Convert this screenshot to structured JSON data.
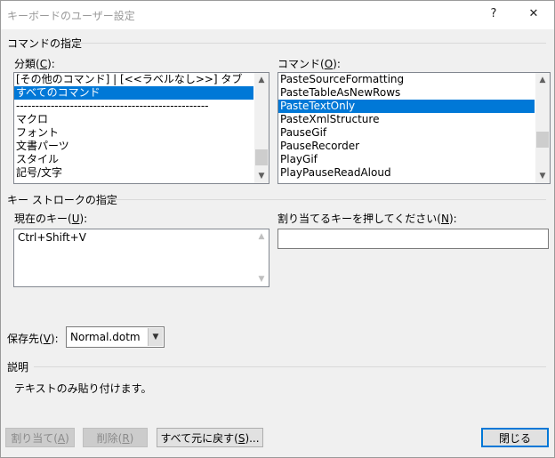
{
  "window": {
    "title": "キーボードのユーザー設定",
    "help_glyph": "?",
    "close_glyph": "✕"
  },
  "command_spec": {
    "heading": "コマンドの指定",
    "categories": {
      "label_pre": "分類(",
      "label_key": "C",
      "label_post": "):",
      "items": [
        {
          "text": "[その他のコマンド] | [<<ラベルなし>>] タブ",
          "selected": false
        },
        {
          "text": "すべてのコマンド",
          "selected": true
        },
        {
          "text": "--------------------------------------------------",
          "selected": false
        },
        {
          "text": "マクロ",
          "selected": false
        },
        {
          "text": "フォント",
          "selected": false
        },
        {
          "text": "文書パーツ",
          "selected": false
        },
        {
          "text": "スタイル",
          "selected": false
        },
        {
          "text": "記号/文字",
          "selected": false
        }
      ]
    },
    "commands": {
      "label_pre": "コマンド(",
      "label_key": "O",
      "label_post": "):",
      "items": [
        {
          "text": "PasteSourceFormatting",
          "selected": false
        },
        {
          "text": "PasteTableAsNewRows",
          "selected": false
        },
        {
          "text": "PasteTextOnly",
          "selected": true
        },
        {
          "text": "PasteXmlStructure",
          "selected": false
        },
        {
          "text": "PauseGif",
          "selected": false
        },
        {
          "text": "PauseRecorder",
          "selected": false
        },
        {
          "text": "PlayGif",
          "selected": false
        },
        {
          "text": "PlayPauseReadAloud",
          "selected": false
        }
      ]
    }
  },
  "keystroke": {
    "heading": "キー ストロークの指定",
    "current_label_pre": "現在のキー(",
    "current_label_key": "U",
    "current_label_post": "):",
    "current_keys": [
      "Ctrl+Shift+V"
    ],
    "new_label_pre": "割り当てるキーを押してください(",
    "new_label_key": "N",
    "new_label_post": "):",
    "new_value": ""
  },
  "save_in": {
    "label_pre": "保存先(",
    "label_key": "V",
    "label_post": "):",
    "value": "Normal.dotm"
  },
  "description": {
    "heading": "説明",
    "text": "テキストのみ貼り付けます。"
  },
  "buttons": {
    "assign": {
      "pre": "割り当て(",
      "key": "A",
      "post": ")",
      "enabled": false
    },
    "remove": {
      "pre": "削除(",
      "key": "R",
      "post": ")",
      "enabled": false
    },
    "reset_all": {
      "pre": "すべて元に戻す(",
      "key": "S",
      "post": ")...",
      "enabled": true
    },
    "close": {
      "label": "閉じる",
      "enabled": true
    }
  },
  "scroll": {
    "up_glyph": "▲",
    "down_glyph": "▼"
  }
}
